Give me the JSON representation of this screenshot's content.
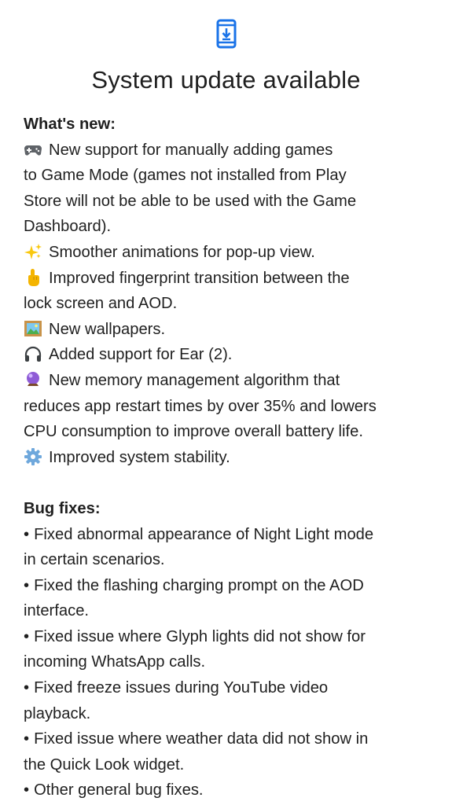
{
  "header": {
    "icon": "system-update-icon",
    "title": "System update available",
    "accent_color": "#1a73e8"
  },
  "whats_new": {
    "heading": "What's new:",
    "items": [
      {
        "icon": "game-controller-icon",
        "lines": [
          "New support for manually adding games",
          "to Game Mode (games not installed from Play",
          "Store will not be able to be used with the Game",
          "Dashboard)."
        ]
      },
      {
        "icon": "sparkles-icon",
        "lines": [
          "Smoother animations for pop-up view."
        ]
      },
      {
        "icon": "pointing-finger-icon",
        "lines": [
          "Improved fingerprint transition between the",
          "lock screen and AOD."
        ]
      },
      {
        "icon": "framed-picture-icon",
        "lines": [
          "New wallpapers."
        ]
      },
      {
        "icon": "headphones-icon",
        "lines": [
          "Added support for Ear (2)."
        ]
      },
      {
        "icon": "crystal-ball-icon",
        "lines": [
          "New memory management algorithm that",
          "reduces app restart times by over 35% and lowers",
          "CPU consumption to improve overall battery life."
        ]
      },
      {
        "icon": "gear-icon",
        "lines": [
          "Improved system stability."
        ]
      }
    ]
  },
  "bug_fixes": {
    "heading": "Bug fixes:",
    "bullet": "•",
    "items": [
      {
        "lines": [
          "Fixed abnormal appearance of Night Light mode",
          "in certain scenarios."
        ]
      },
      {
        "lines": [
          "Fixed the flashing charging prompt on the AOD",
          "interface."
        ]
      },
      {
        "lines": [
          "Fixed issue where Glyph lights did not show for",
          "incoming WhatsApp calls."
        ]
      },
      {
        "lines": [
          "Fixed freeze issues during YouTube video",
          "playback."
        ]
      },
      {
        "lines": [
          "Fixed issue where weather data did not show in",
          "the Quick Look widget."
        ]
      },
      {
        "lines": [
          "Other general bug fixes."
        ]
      }
    ]
  }
}
